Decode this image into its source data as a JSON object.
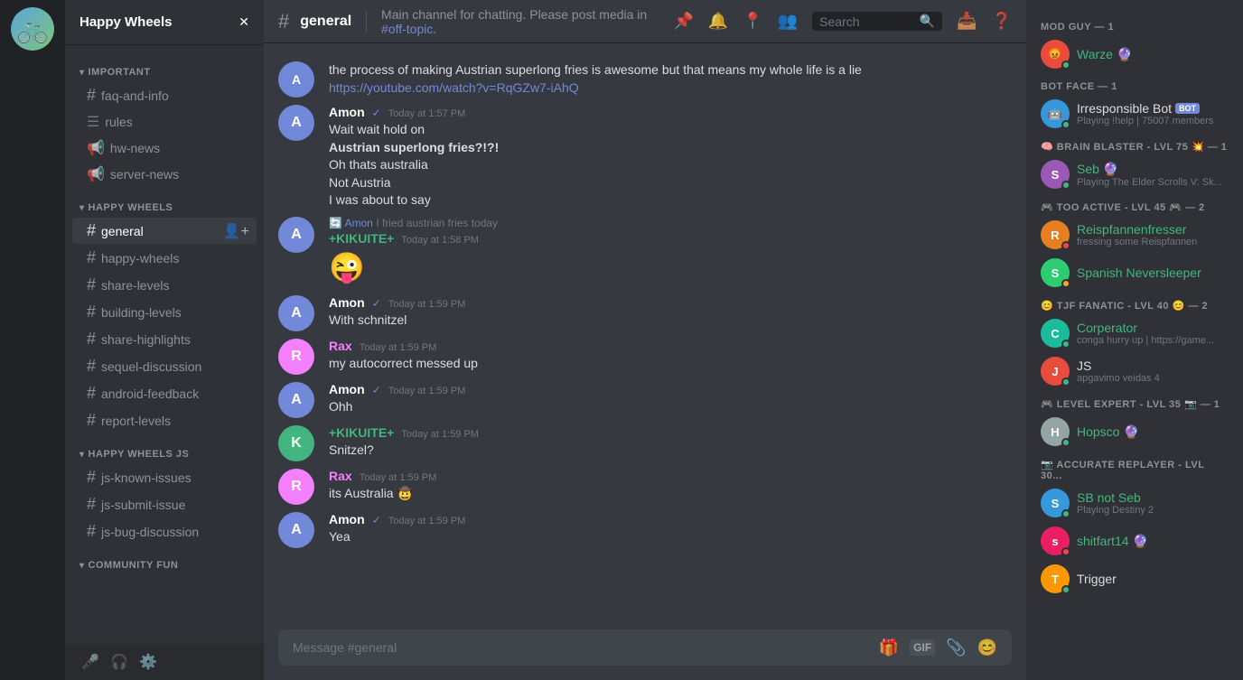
{
  "server": {
    "name": "Happy Wheels",
    "icon_text": "HW"
  },
  "sidebar": {
    "categories": [
      {
        "name": "IMPORTANT",
        "channels": [
          {
            "name": "faq-and-info",
            "icon": "hash"
          },
          {
            "name": "rules",
            "icon": "list"
          },
          {
            "name": "hw-news",
            "icon": "megaphone"
          },
          {
            "name": "server-news",
            "icon": "megaphone"
          }
        ]
      },
      {
        "name": "HAPPY WHEELS",
        "channels": [
          {
            "name": "general",
            "icon": "hash",
            "active": true
          },
          {
            "name": "happy-wheels",
            "icon": "hash"
          },
          {
            "name": "share-levels",
            "icon": "hash"
          },
          {
            "name": "building-levels",
            "icon": "hash"
          },
          {
            "name": "share-highlights",
            "icon": "hash"
          },
          {
            "name": "sequel-discussion",
            "icon": "hash"
          },
          {
            "name": "android-feedback",
            "icon": "hash"
          },
          {
            "name": "report-levels",
            "icon": "hash"
          }
        ]
      },
      {
        "name": "HAPPY WHEELS JS",
        "channels": [
          {
            "name": "js-known-issues",
            "icon": "hash"
          },
          {
            "name": "js-submit-issue",
            "icon": "hash"
          },
          {
            "name": "js-bug-discussion",
            "icon": "hash"
          }
        ]
      },
      {
        "name": "COMMUNITY FUN",
        "channels": []
      }
    ]
  },
  "header": {
    "channel": "general",
    "description": "Main channel for chatting. Please post media in",
    "link_text": "#off-topic",
    "link_url": "#off-topic"
  },
  "search": {
    "placeholder": "Search"
  },
  "messages": [
    {
      "id": "msg1",
      "avatar_color": "av-purple-prev",
      "type": "continuation",
      "text": "the process of making Austrian superlong fries is awesome but that means my whole life is a lie",
      "link": "https://youtube.com/watch?v=RqGZw7-iAhQ",
      "link_text": "https://youtube.com/watch?v=RqGZw7-iAhQ"
    },
    {
      "id": "msg2",
      "avatar_initials": "A",
      "avatar_color": "avatar-amon",
      "author": "Amon",
      "author_class": "author-amon",
      "verified": true,
      "time": "Today at 1:57 PM",
      "texts": [
        "Wait wait hold on",
        "Austrian superlong fries?!?!",
        "Oh thats australia",
        "Not Austria",
        "I was about to say"
      ],
      "bold_line": 1
    },
    {
      "id": "msg3",
      "avatar_initials": "A",
      "avatar_color": "avatar-amon",
      "author": "Amon",
      "author_class": "author-amon",
      "verified": true,
      "time": "I fried austrian fries today",
      "is_reply_context": true
    },
    {
      "id": "msg4",
      "avatar_initials": "K",
      "avatar_color": "avatar-kikuite",
      "author": "+KIKUITE+",
      "author_class": "author-kikuite",
      "plus": true,
      "time": "Today at 1:58 PM",
      "emoji": "😜"
    },
    {
      "id": "msg5",
      "avatar_initials": "A",
      "avatar_color": "avatar-amon",
      "author": "Amon",
      "author_class": "author-amon",
      "verified": true,
      "time": "Today at 1:59 PM",
      "texts": [
        "With schnitzel"
      ]
    },
    {
      "id": "msg6",
      "avatar_initials": "R",
      "avatar_color": "avatar-rax",
      "author": "Rax",
      "author_class": "author-rax",
      "time": "Today at 1:59 PM",
      "texts": [
        "my autocorrect messed up"
      ]
    },
    {
      "id": "msg7",
      "avatar_initials": "A",
      "avatar_color": "avatar-amon",
      "author": "Amon",
      "author_class": "author-amon",
      "verified": true,
      "time": "Today at 1:59 PM",
      "texts": [
        "Ohh"
      ]
    },
    {
      "id": "msg8",
      "avatar_initials": "K",
      "avatar_color": "avatar-kikuite",
      "author": "+KIKUITE+",
      "author_class": "author-kikuite",
      "plus": true,
      "time": "Today at 1:59 PM",
      "texts": [
        "Snitzel?"
      ]
    },
    {
      "id": "msg9",
      "avatar_initials": "R",
      "avatar_color": "avatar-rax",
      "author": "Rax",
      "author_class": "author-rax",
      "time": "Today at 1:59 PM",
      "texts": [
        "its Australia 🤠"
      ]
    },
    {
      "id": "msg10",
      "avatar_initials": "A",
      "avatar_color": "avatar-amon",
      "author": "Amon",
      "author_class": "author-amon",
      "verified": true,
      "time": "Today at 1:59 PM",
      "texts": [
        "Yea"
      ]
    }
  ],
  "chat_input": {
    "placeholder": "Message #general"
  },
  "members": {
    "sections": [
      {
        "category": "MOD GUY — 1",
        "members": [
          {
            "name": "Warze",
            "color": "name-green",
            "avatar_color": "av-warze",
            "initials": "W",
            "status": "status-online",
            "emoji": "😡",
            "sub": "",
            "verified_emoji": "🔮"
          }
        ]
      },
      {
        "category": "BOT FACE — 1",
        "members": [
          {
            "name": "Irresponsible Bot",
            "color": "name-white",
            "avatar_color": "av-irresponsible",
            "initials": "I",
            "status": "status-online",
            "is_bot": true,
            "sub": "Playing !help | 75007 members"
          }
        ]
      },
      {
        "category": "🧠 BRAIN BLASTER - LVL 75 💥 — 1",
        "members": [
          {
            "name": "Seb",
            "color": "name-green",
            "avatar_color": "av-seb",
            "initials": "S",
            "status": "status-online",
            "verified_emoji": "🔮",
            "sub": "Playing The Elder Scrolls V: Sk..."
          }
        ]
      },
      {
        "category": "🎮 TOO ACTIVE - LVL 45 🎮 — 2",
        "members": [
          {
            "name": "Reispfannenfresser",
            "color": "name-green",
            "avatar_color": "av-reispfannen",
            "initials": "R",
            "status": "status-dnd",
            "sub": "fressing some Reispfannen"
          },
          {
            "name": "Spanish Neversleeper",
            "color": "name-green",
            "avatar_color": "av-spanish",
            "initials": "S",
            "status": "status-idle",
            "sub": ""
          }
        ]
      },
      {
        "category": "😊 TJF FANATIC - LVL 40 😊 — 2",
        "members": [
          {
            "name": "Corperator",
            "color": "name-green",
            "avatar_color": "av-corperator",
            "initials": "C",
            "status": "status-online",
            "sub": "conga hurry up | https://game..."
          },
          {
            "name": "JS",
            "color": "name-white",
            "avatar_color": "av-js",
            "initials": "J",
            "status": "status-online",
            "sub": "apgavimo veidas 4"
          }
        ]
      },
      {
        "category": "🎮 LEVEL EXPERT - LVL 35 📷 — 1",
        "members": [
          {
            "name": "Hopsco",
            "color": "name-green",
            "avatar_color": "av-hopsco",
            "initials": "H",
            "status": "status-online",
            "verified_emoji": "🔮",
            "sub": ""
          }
        ]
      },
      {
        "category": "📷 ACCURATE REPLAYER - LVL 30... ",
        "members": [
          {
            "name": "SB not Seb",
            "color": "name-green",
            "avatar_color": "av-sb",
            "initials": "S",
            "status": "status-online",
            "sub": "Playing Destiny 2"
          },
          {
            "name": "shitfart14",
            "color": "name-green",
            "avatar_color": "av-shitfart",
            "initials": "s",
            "status": "status-dnd",
            "verified_emoji": "🔮",
            "sub": ""
          },
          {
            "name": "Trigger",
            "color": "name-white",
            "avatar_color": "av-trigger",
            "initials": "T",
            "status": "status-online",
            "sub": ""
          }
        ]
      }
    ]
  },
  "footer_icons": [
    "🎤",
    "🎧",
    "⚙️"
  ]
}
